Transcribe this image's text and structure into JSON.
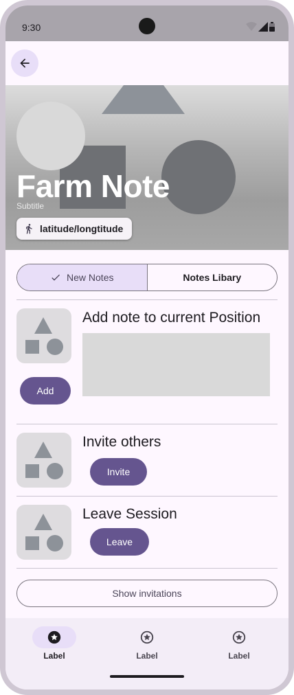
{
  "status": {
    "time": "9:30"
  },
  "hero": {
    "title": "Farm Note",
    "subtitle": "Subtitle",
    "location_chip": "latitude/longtitude"
  },
  "tabs": [
    {
      "label": "New Notes",
      "selected": true
    },
    {
      "label": "Notes Libary",
      "selected": false
    }
  ],
  "sections": {
    "add_note": {
      "title": "Add note to current Position",
      "button": "Add"
    },
    "invite": {
      "title": "Invite others",
      "button": "Invite"
    },
    "leave": {
      "title": "Leave Session",
      "button": "Leave"
    }
  },
  "show_invitations": "Show invitations",
  "nav": [
    {
      "label": "Label",
      "icon": "star-icon",
      "active": true
    },
    {
      "label": "Label",
      "icon": "star-icon",
      "active": false
    },
    {
      "label": "Label",
      "icon": "star-icon",
      "active": false
    }
  ],
  "colors": {
    "primary": "#65558f",
    "secondary_container": "#e8def8",
    "surface": "#fef7ff",
    "outline": "#79747e"
  }
}
